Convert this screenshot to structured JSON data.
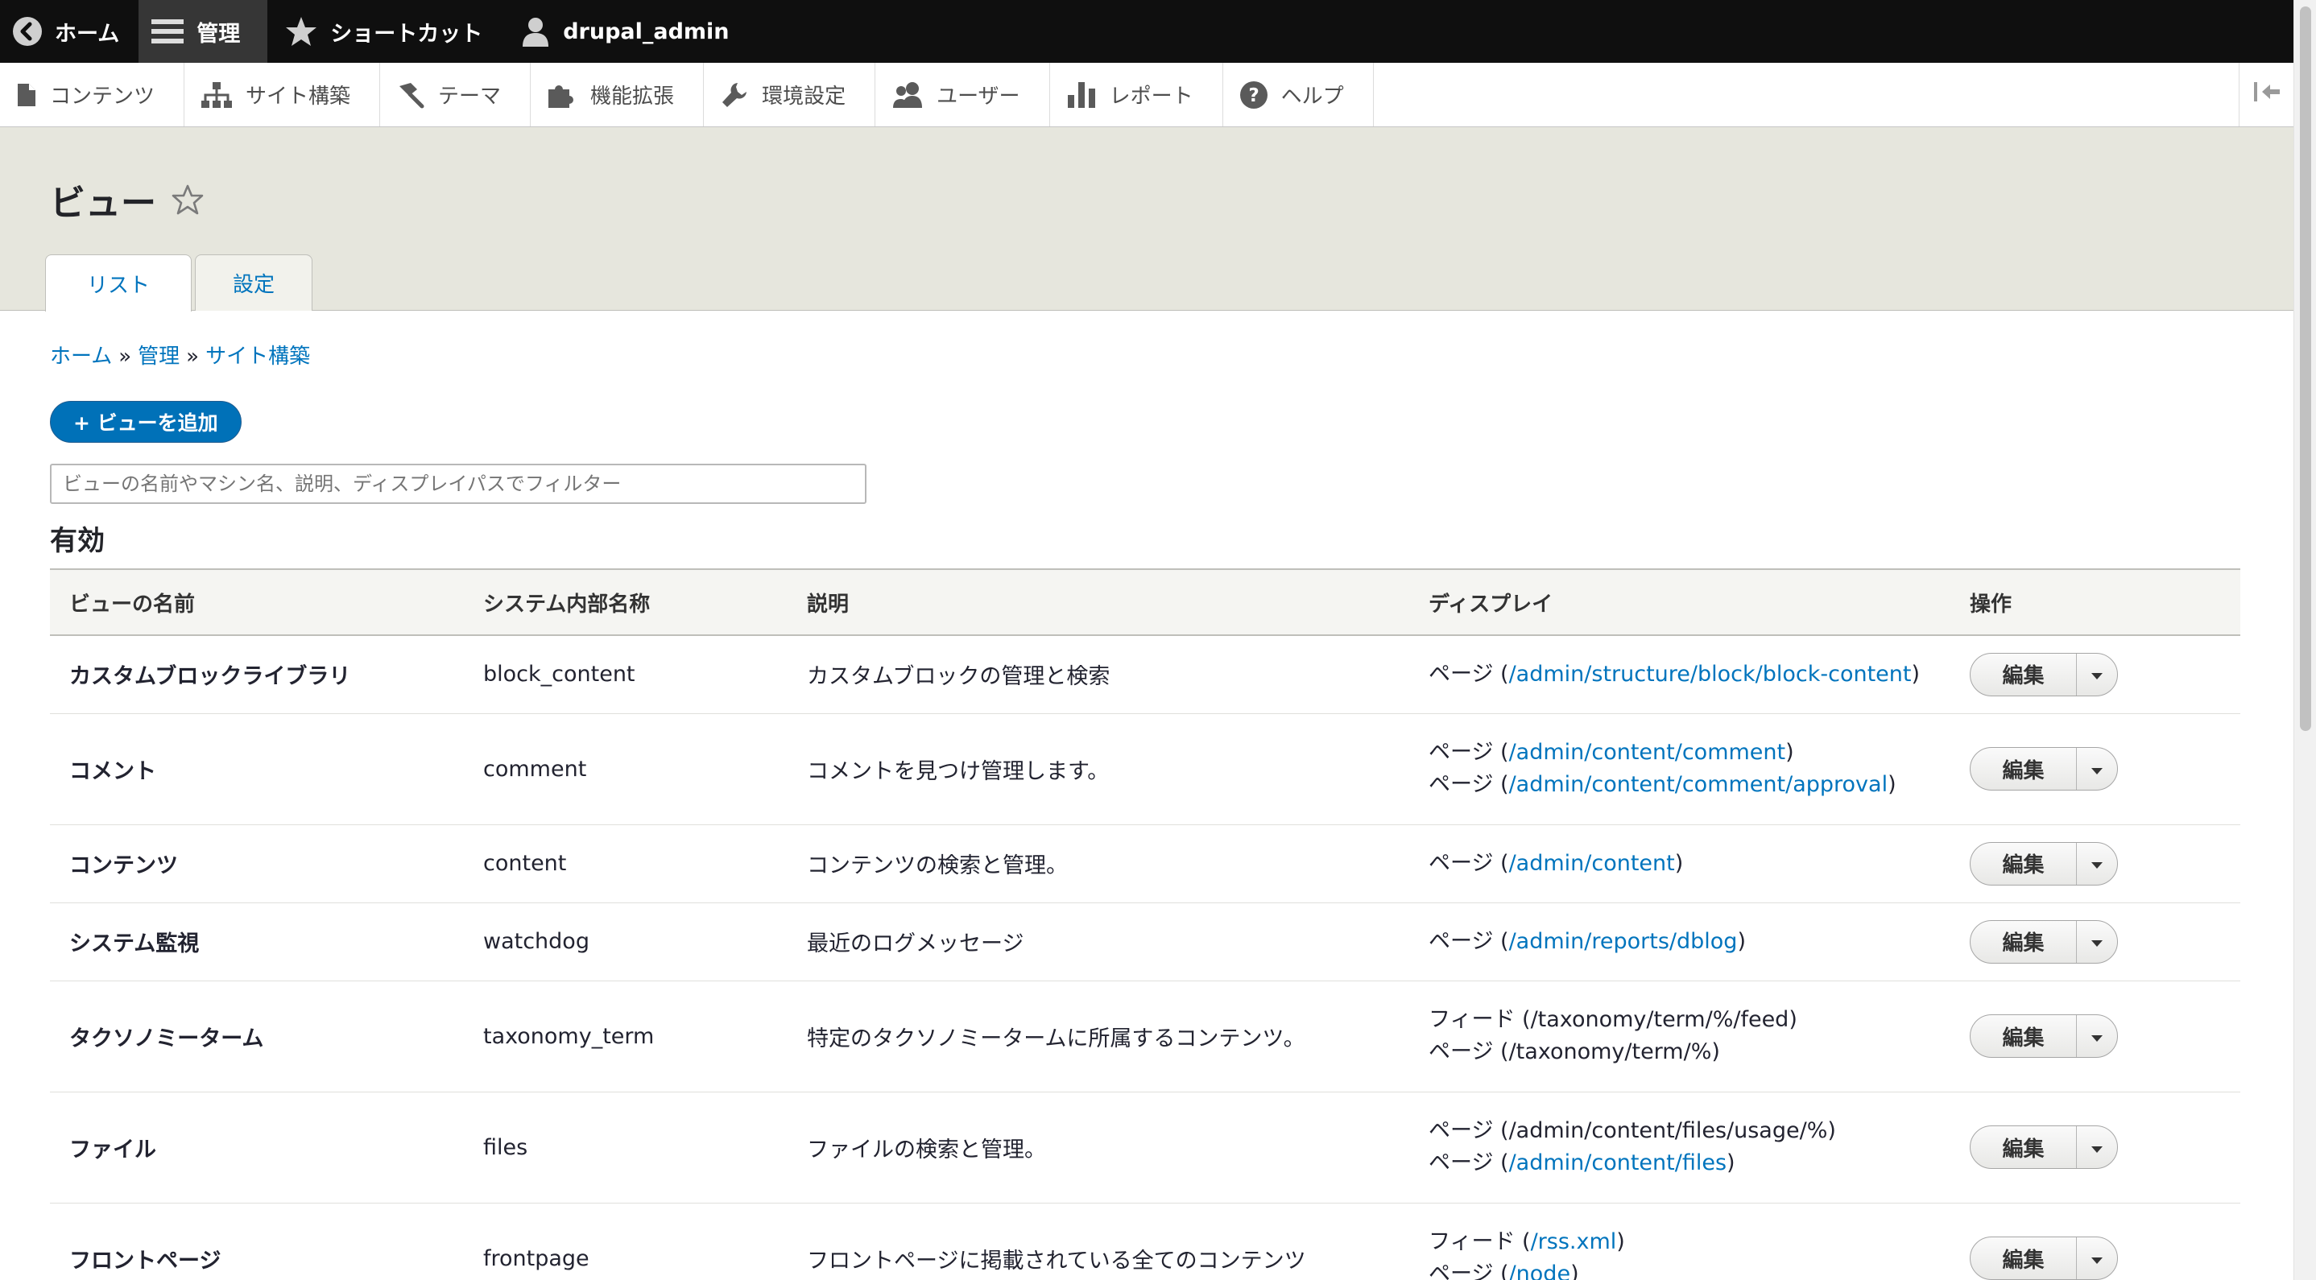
{
  "toolbar": {
    "home_label": "ホーム",
    "manage_label": "管理",
    "shortcuts_label": "ショートカット",
    "user_label": "drupal_admin"
  },
  "admin_menu": {
    "items": [
      {
        "label": "コンテンツ",
        "icon": "page-icon"
      },
      {
        "label": "サイト構築",
        "icon": "sitemap-icon"
      },
      {
        "label": "テーマ",
        "icon": "paintbrush-icon"
      },
      {
        "label": "機能拡張",
        "icon": "puzzle-icon"
      },
      {
        "label": "環境設定",
        "icon": "wrench-icon"
      },
      {
        "label": "ユーザー",
        "icon": "people-icon"
      },
      {
        "label": "レポート",
        "icon": "bar-chart-icon"
      },
      {
        "label": "ヘルプ",
        "icon": "help-icon"
      }
    ]
  },
  "page": {
    "title": "ビュー",
    "tabs": [
      {
        "label": "リスト"
      },
      {
        "label": "設定"
      }
    ],
    "breadcrumb": [
      "ホーム",
      "管理",
      "サイト構築"
    ],
    "breadcrumb_separator": "»",
    "add_view_label": "+ ビューを追加",
    "filter_placeholder": "ビューの名前やマシン名、説明、ディスプレイパスでフィルター",
    "section_enabled": "有効"
  },
  "table": {
    "headers": {
      "name": "ビューの名前",
      "machine": "システム内部名称",
      "desc": "説明",
      "display": "ディスプレイ",
      "ops": "操作"
    },
    "edit_label": "編集",
    "rows": [
      {
        "name": "カスタムブロックライブラリ",
        "machine": "block_content",
        "desc": "カスタムブロックの管理と検索",
        "displays": [
          {
            "prefix": "ページ (",
            "path": "/admin/structure/block/block-content",
            "linked": true,
            "suffix": ")"
          }
        ]
      },
      {
        "name": "コメント",
        "machine": "comment",
        "desc": "コメントを見つけ管理します。",
        "displays": [
          {
            "prefix": "ページ (",
            "path": "/admin/content/comment",
            "linked": true,
            "suffix": ")"
          },
          {
            "prefix": "ページ (",
            "path": "/admin/content/comment/approval",
            "linked": true,
            "suffix": ")"
          }
        ]
      },
      {
        "name": "コンテンツ",
        "machine": "content",
        "desc": "コンテンツの検索と管理。",
        "displays": [
          {
            "prefix": "ページ (",
            "path": "/admin/content",
            "linked": true,
            "suffix": ")"
          }
        ]
      },
      {
        "name": "システム監視",
        "machine": "watchdog",
        "desc": "最近のログメッセージ",
        "displays": [
          {
            "prefix": "ページ (",
            "path": "/admin/reports/dblog",
            "linked": true,
            "suffix": ")"
          }
        ]
      },
      {
        "name": "タクソノミーターム",
        "machine": "taxonomy_term",
        "desc": "特定のタクソノミータームに所属するコンテンツ。",
        "displays": [
          {
            "prefix": "フィード (",
            "path": "/taxonomy/term/%/feed",
            "linked": false,
            "suffix": ")"
          },
          {
            "prefix": "ページ (",
            "path": "/taxonomy/term/%",
            "linked": false,
            "suffix": ")"
          }
        ]
      },
      {
        "name": "ファイル",
        "machine": "files",
        "desc": "ファイルの検索と管理。",
        "displays": [
          {
            "prefix": "ページ (",
            "path": "/admin/content/files/usage/%",
            "linked": false,
            "suffix": ")"
          },
          {
            "prefix": "ページ (",
            "path": "/admin/content/files",
            "linked": true,
            "suffix": ")"
          }
        ]
      },
      {
        "name": "フロントページ",
        "machine": "frontpage",
        "desc": "フロントページに掲載されている全てのコンテンツ",
        "displays": [
          {
            "prefix": "フィード (",
            "path": "/rss.xml",
            "linked": true,
            "suffix": ")"
          },
          {
            "prefix": "ページ (",
            "path": "/node",
            "linked": true,
            "suffix": ")"
          }
        ]
      }
    ]
  },
  "colors": {
    "link": "#0074bd",
    "primary_button": "#0071b8",
    "toolbar_bg": "#0f0f0f",
    "header_bg": "#e6e6dd"
  }
}
